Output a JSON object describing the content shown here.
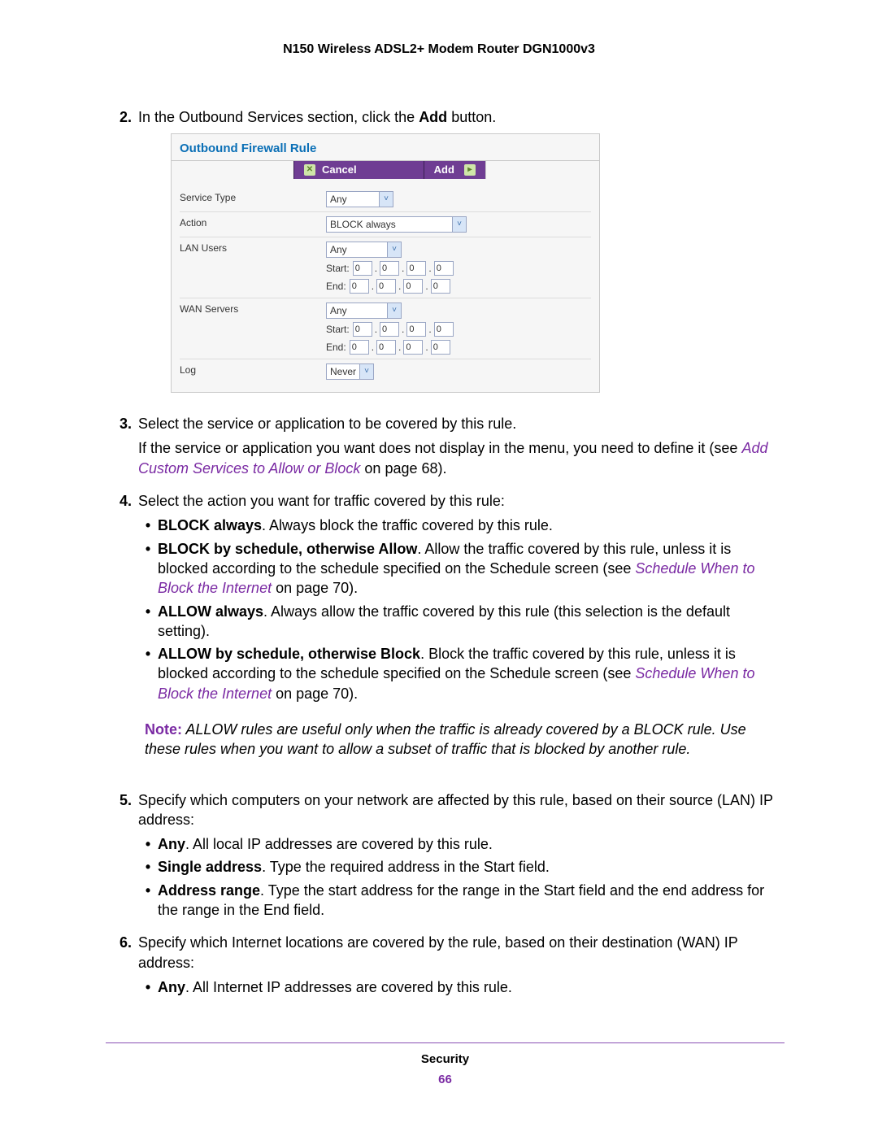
{
  "header": {
    "title": "N150 Wireless ADSL2+ Modem Router DGN1000v3"
  },
  "steps": {
    "s2": {
      "num": "2.",
      "line": {
        "pre": "In the Outbound Services section, click the ",
        "bold": "Add",
        "post": " button."
      }
    },
    "s3": {
      "num": "3.",
      "l1": "Select the service or application to be covered by this rule.",
      "l2a": "If the service or application you want does not display in the menu, you need to define it (see ",
      "l2link": "Add Custom Services to Allow or Block",
      "l2b": " on page 68)."
    },
    "s4": {
      "num": "4.",
      "intro": "Select the action you want for traffic covered by this rule:",
      "b1": {
        "bold": "BLOCK always",
        "rest": ". Always block the traffic covered by this rule."
      },
      "b2": {
        "bold": "BLOCK by schedule, otherwise Allow",
        "rest_a": ". Allow the traffic covered by this rule, unless it is blocked according to the schedule specified on the Schedule screen (see ",
        "link": "Schedule When to Block the Internet",
        "rest_b": " on page 70)."
      },
      "b3": {
        "bold": "ALLOW always",
        "rest": ". Always allow the traffic covered by this rule (this selection is the default setting)."
      },
      "b4": {
        "bold": "ALLOW by schedule, otherwise Block",
        "rest_a": ". Block the traffic covered by this rule, unless it is blocked according to the schedule specified on the Schedule screen (see ",
        "link": "Schedule When to Block the Internet",
        "rest_b": " on page 70)."
      },
      "note": {
        "lead": "Note:",
        "text": "  ALLOW rules are useful only when the traffic is already covered by a BLOCK rule. Use these rules when you want to allow a subset of traffic that is blocked by another rule."
      }
    },
    "s5": {
      "num": "5.",
      "intro": "Specify which computers on your network are affected by this rule, based on their source (LAN) IP address:",
      "b1": {
        "bold": "Any",
        "rest": ". All local IP addresses are covered by this rule."
      },
      "b2": {
        "bold": "Single address",
        "rest": ". Type the required address in the Start field."
      },
      "b3": {
        "bold": "Address range",
        "rest": ". Type the start address for the range in the Start field and the end address for the range in the End field."
      }
    },
    "s6": {
      "num": "6.",
      "intro": "Specify which Internet locations are covered by the rule, based on their destination (WAN) IP address:",
      "b1": {
        "bold": "Any",
        "rest": ". All Internet IP addresses are covered by this rule."
      }
    }
  },
  "panel": {
    "title": "Outbound Firewall Rule",
    "buttons": {
      "cancel": "Cancel",
      "add": "Add"
    },
    "labels": {
      "service_type": "Service Type",
      "action": "Action",
      "lan_users": "LAN Users",
      "wan_servers": "WAN Servers",
      "log": "Log",
      "start": "Start:",
      "end": "End:"
    },
    "values": {
      "service_type": "Any",
      "action": "BLOCK always",
      "lan_users": "Any",
      "wan_servers": "Any",
      "log": "Never",
      "ip_octet": "0"
    }
  },
  "footer": {
    "section": "Security",
    "page": "66"
  },
  "bullet": "•"
}
